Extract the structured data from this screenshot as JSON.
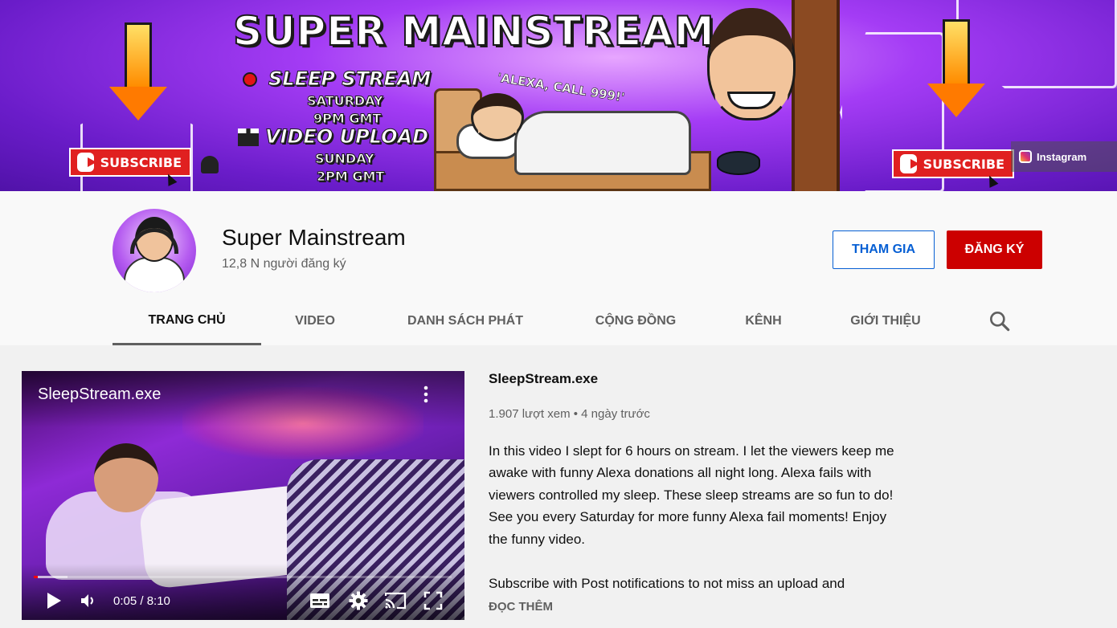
{
  "banner": {
    "title": "SUPER MAINSTREAM",
    "sleep_stream": "SLEEP STREAM",
    "sleep_day": "SATURDAY",
    "sleep_time": "9PM GMT",
    "video_upload": "VIDEO UPLOAD",
    "upload_day": "SUNDAY",
    "upload_time": "2PM GMT",
    "speech": "'ALEXA, CALL 999!'",
    "subscribe_badge": "SUBSCRIBE",
    "instagram_link": "Instagram"
  },
  "channel": {
    "name": "Super Mainstream",
    "subscribers": "12,8 N người đăng ký",
    "join_label": "THAM GIA",
    "subscribe_label": "ĐĂNG KÝ"
  },
  "tabs": [
    {
      "label": "TRANG CHỦ",
      "active": true
    },
    {
      "label": "VIDEO",
      "active": false
    },
    {
      "label": "DANH SÁCH PHÁT",
      "active": false
    },
    {
      "label": "CỘNG ĐỒNG",
      "active": false
    },
    {
      "label": "KÊNH",
      "active": false
    },
    {
      "label": "GIỚI THIỆU",
      "active": false
    }
  ],
  "featured_video": {
    "player_title": "SleepStream.exe",
    "current_time": "0:05",
    "duration": "8:10",
    "time_display": "0:05 / 8:10",
    "progress_fraction": 0.0102,
    "buffered_fraction": 0.08,
    "title": "SleepStream.exe",
    "meta": "1.907 lượt xem • 4 ngày trước",
    "description": "In this video I slept for 6 hours on stream. I let the viewers keep me awake with funny Alexa donations all night long. Alexa fails with viewers controlled my sleep. These sleep streams are so fun to do! See you every Saturday for more funny Alexa fail moments! Enjoy the funny video.",
    "description_line2": "Subscribe with Post notifications to not miss an upload and",
    "read_more": "ĐỌC THÊM"
  },
  "icons": {
    "search": "search-icon",
    "more": "more-vert-icon",
    "play": "play-icon",
    "volume": "volume-icon",
    "subtitles": "subtitles-icon",
    "settings": "gear-icon",
    "cast": "cast-icon",
    "fullscreen": "fullscreen-icon"
  },
  "colors": {
    "subscribe_red": "#cc0000",
    "join_blue": "#065fd4",
    "progress_red": "#ff0000"
  }
}
